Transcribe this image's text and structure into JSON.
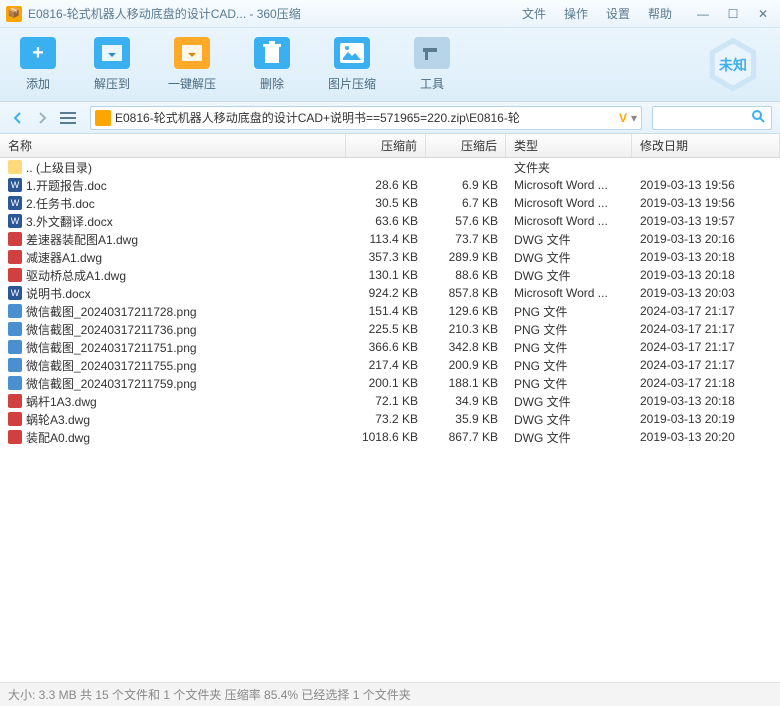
{
  "window": {
    "title": "E0816-轮式机器人移动底盘的设计CAD... - 360压缩"
  },
  "menu": {
    "file": "文件",
    "operate": "操作",
    "settings": "设置",
    "help": "帮助"
  },
  "toolbar": {
    "add": "添加",
    "extract": "解压到",
    "oneclick": "一键解压",
    "delete": "删除",
    "imgcompress": "图片压缩",
    "tools": "工具",
    "badge": "未知"
  },
  "nav": {
    "path": "E0816-轮式机器人移动底盘的设计CAD+说明书==571965=220.zip\\E0816-轮"
  },
  "columns": {
    "name": "名称",
    "before": "压缩前",
    "after": "压缩后",
    "type": "类型",
    "date": "修改日期"
  },
  "files": [
    {
      "icon": "folder",
      "name": ".. (上级目录)",
      "before": "",
      "after": "",
      "type": "文件夹",
      "date": ""
    },
    {
      "icon": "doc",
      "name": "1.开题报告.doc",
      "before": "28.6 KB",
      "after": "6.9 KB",
      "type": "Microsoft Word ...",
      "date": "2019-03-13 19:56"
    },
    {
      "icon": "doc",
      "name": "2.任务书.doc",
      "before": "30.5 KB",
      "after": "6.7 KB",
      "type": "Microsoft Word ...",
      "date": "2019-03-13 19:56"
    },
    {
      "icon": "doc",
      "name": "3.外文翻译.docx",
      "before": "63.6 KB",
      "after": "57.6 KB",
      "type": "Microsoft Word ...",
      "date": "2019-03-13 19:57"
    },
    {
      "icon": "dwg",
      "name": "差速器装配图A1.dwg",
      "before": "113.4 KB",
      "after": "73.7 KB",
      "type": "DWG 文件",
      "date": "2019-03-13 20:16"
    },
    {
      "icon": "dwg",
      "name": "减速器A1.dwg",
      "before": "357.3 KB",
      "after": "289.9 KB",
      "type": "DWG 文件",
      "date": "2019-03-13 20:18"
    },
    {
      "icon": "dwg",
      "name": "驱动桥总成A1.dwg",
      "before": "130.1 KB",
      "after": "88.6 KB",
      "type": "DWG 文件",
      "date": "2019-03-13 20:18"
    },
    {
      "icon": "doc",
      "name": "说明书.docx",
      "before": "924.2 KB",
      "after": "857.8 KB",
      "type": "Microsoft Word ...",
      "date": "2019-03-13 20:03"
    },
    {
      "icon": "png",
      "name": "微信截图_20240317211728.png",
      "before": "151.4 KB",
      "after": "129.6 KB",
      "type": "PNG 文件",
      "date": "2024-03-17 21:17"
    },
    {
      "icon": "png",
      "name": "微信截图_20240317211736.png",
      "before": "225.5 KB",
      "after": "210.3 KB",
      "type": "PNG 文件",
      "date": "2024-03-17 21:17"
    },
    {
      "icon": "png",
      "name": "微信截图_20240317211751.png",
      "before": "366.6 KB",
      "after": "342.8 KB",
      "type": "PNG 文件",
      "date": "2024-03-17 21:17"
    },
    {
      "icon": "png",
      "name": "微信截图_20240317211755.png",
      "before": "217.4 KB",
      "after": "200.9 KB",
      "type": "PNG 文件",
      "date": "2024-03-17 21:17"
    },
    {
      "icon": "png",
      "name": "微信截图_20240317211759.png",
      "before": "200.1 KB",
      "after": "188.1 KB",
      "type": "PNG 文件",
      "date": "2024-03-17 21:18"
    },
    {
      "icon": "dwg",
      "name": "蜗杆1A3.dwg",
      "before": "72.1 KB",
      "after": "34.9 KB",
      "type": "DWG 文件",
      "date": "2019-03-13 20:18"
    },
    {
      "icon": "dwg",
      "name": "蜗轮A3.dwg",
      "before": "73.2 KB",
      "after": "35.9 KB",
      "type": "DWG 文件",
      "date": "2019-03-13 20:19"
    },
    {
      "icon": "dwg",
      "name": "装配A0.dwg",
      "before": "1018.6 KB",
      "after": "867.7 KB",
      "type": "DWG 文件",
      "date": "2019-03-13 20:20"
    }
  ],
  "status": "大小: 3.3 MB 共 15 个文件和 1 个文件夹 压缩率 85.4%  已经选择 1 个文件夹"
}
